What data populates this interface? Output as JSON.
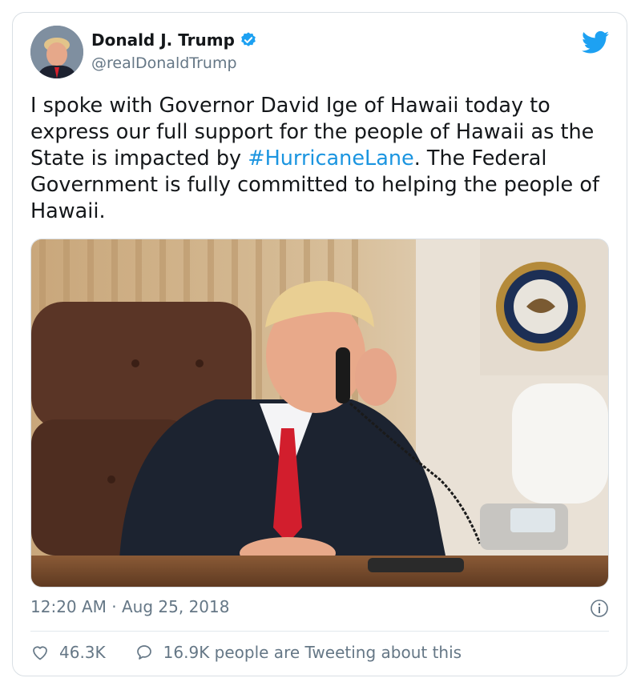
{
  "author": {
    "name": "Donald J. Trump",
    "handle": "@realDonaldTrump",
    "verified": true
  },
  "tweet": {
    "text_before": "I spoke with Governor David Ige of Hawaii today to express our full support for the people of Hawaii as the State is impacted by ",
    "hashtag": "#HurricaneLane",
    "text_after": ". The Federal Government is fully committed to helping the people of Hawaii."
  },
  "meta": {
    "timestamp": "12:20 AM · Aug 25, 2018"
  },
  "actions": {
    "likes": "46.3K",
    "conversation": "16.9K people are Tweeting about this"
  },
  "colors": {
    "accent": "#1da1f2",
    "link": "#1b95e0",
    "secondary_text": "#657786"
  },
  "icons": {
    "logo": "twitter-bird-icon",
    "verified": "verified-badge-icon",
    "info": "info-icon",
    "like": "heart-icon",
    "reply": "speech-bubble-icon"
  }
}
